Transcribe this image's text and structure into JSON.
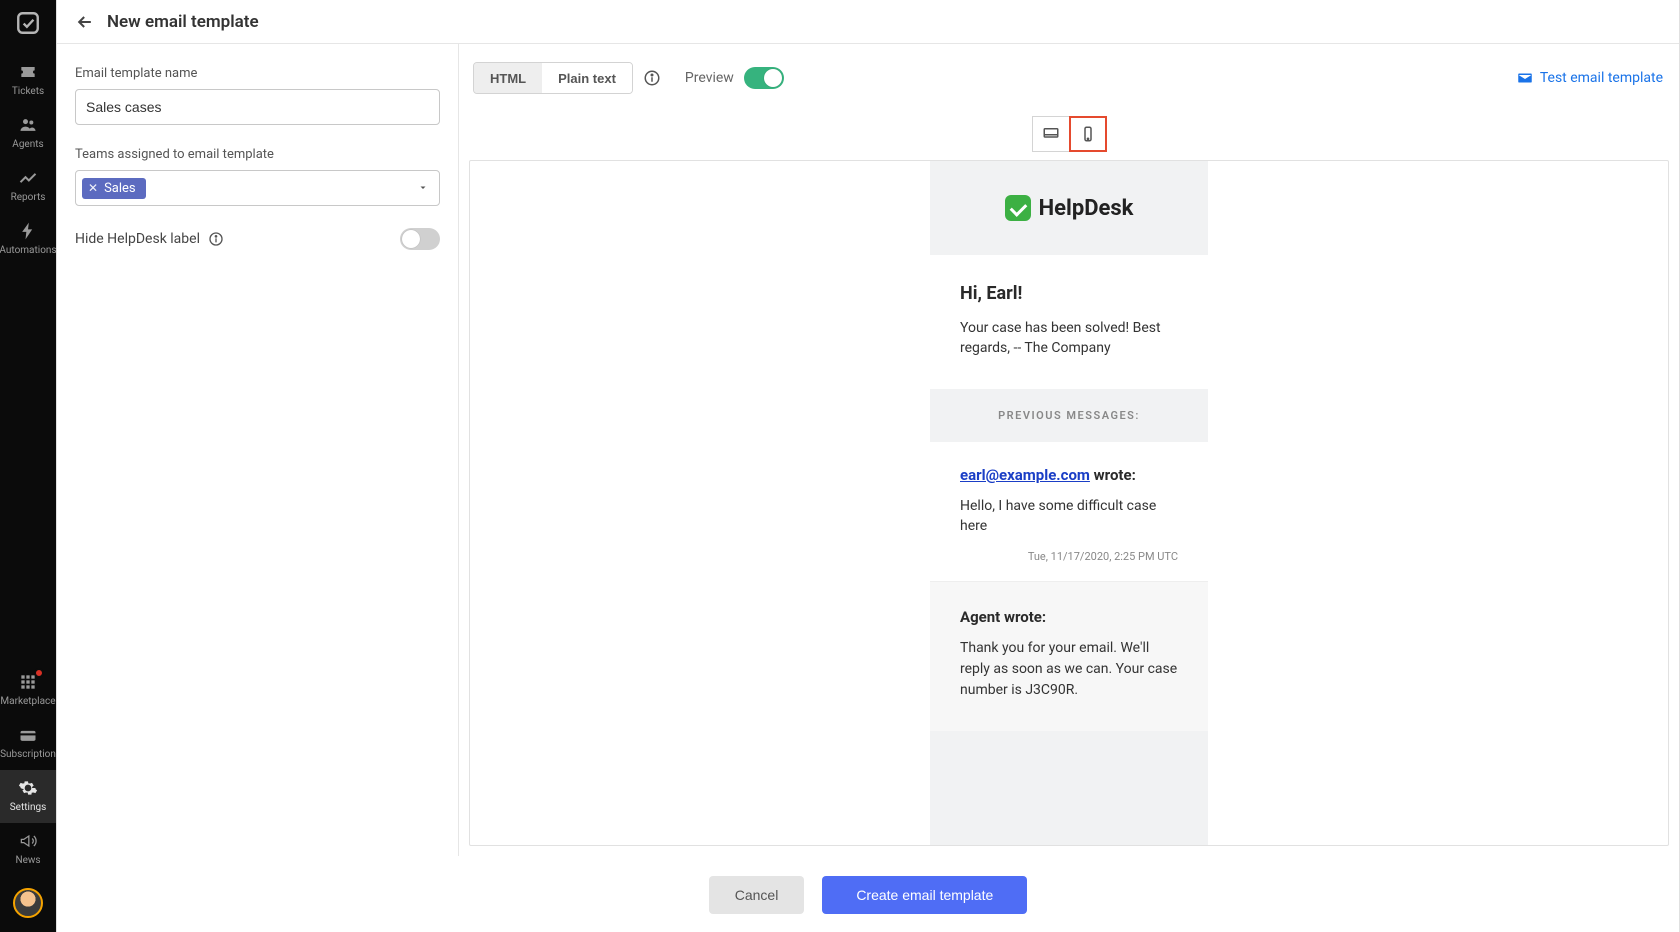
{
  "sidebar": {
    "items": [
      {
        "id": "tickets",
        "label": "Tickets"
      },
      {
        "id": "agents",
        "label": "Agents"
      },
      {
        "id": "reports",
        "label": "Reports"
      },
      {
        "id": "automations",
        "label": "Automations"
      }
    ],
    "bottom": [
      {
        "id": "marketplace",
        "label": "Marketplace",
        "badge": true
      },
      {
        "id": "subscription",
        "label": "Subscription"
      },
      {
        "id": "settings",
        "label": "Settings",
        "active": true
      },
      {
        "id": "news",
        "label": "News"
      }
    ]
  },
  "header": {
    "title": "New email template"
  },
  "form": {
    "name_label": "Email template name",
    "name_value": "Sales cases",
    "teams_label": "Teams assigned to email template",
    "team_chip": "Sales",
    "hide_label": "Hide HelpDesk label",
    "hide_on": false
  },
  "toolbar": {
    "seg_html": "HTML",
    "seg_plain": "Plain text",
    "preview_label": "Preview",
    "preview_on": true,
    "test_link": "Test email template"
  },
  "device": {
    "active": "mobile"
  },
  "email": {
    "brand": "HelpDesk",
    "greeting": "Hi, Earl!",
    "body": "Your case has been solved! Best regards, -- The Company",
    "prev_label": "PREVIOUS MESSAGES:",
    "quote_email": "earl@example.com",
    "quote_wrote": " wrote:",
    "quote_msg": "Hello, I have some difficult case here",
    "quote_ts": "Tue, 11/17/2020, 2:25 PM UTC",
    "agent_wrote": "Agent wrote:",
    "agent_msg": "Thank you for your email. We'll reply as soon as we can. Your case number is J3C90R."
  },
  "footer": {
    "cancel": "Cancel",
    "create": "Create email template"
  }
}
